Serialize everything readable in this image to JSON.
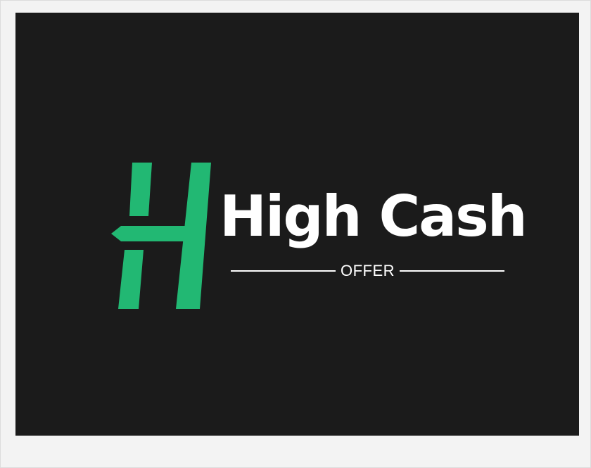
{
  "logo": {
    "brand_name": "High Cash",
    "tagline": "OFFER",
    "mark_letter": "H",
    "colors": {
      "background": "#1b1b1b",
      "accent": "#22b873",
      "text": "#ffffff",
      "page": "#f3f3f3"
    },
    "icon": "h-monogram-icon"
  }
}
